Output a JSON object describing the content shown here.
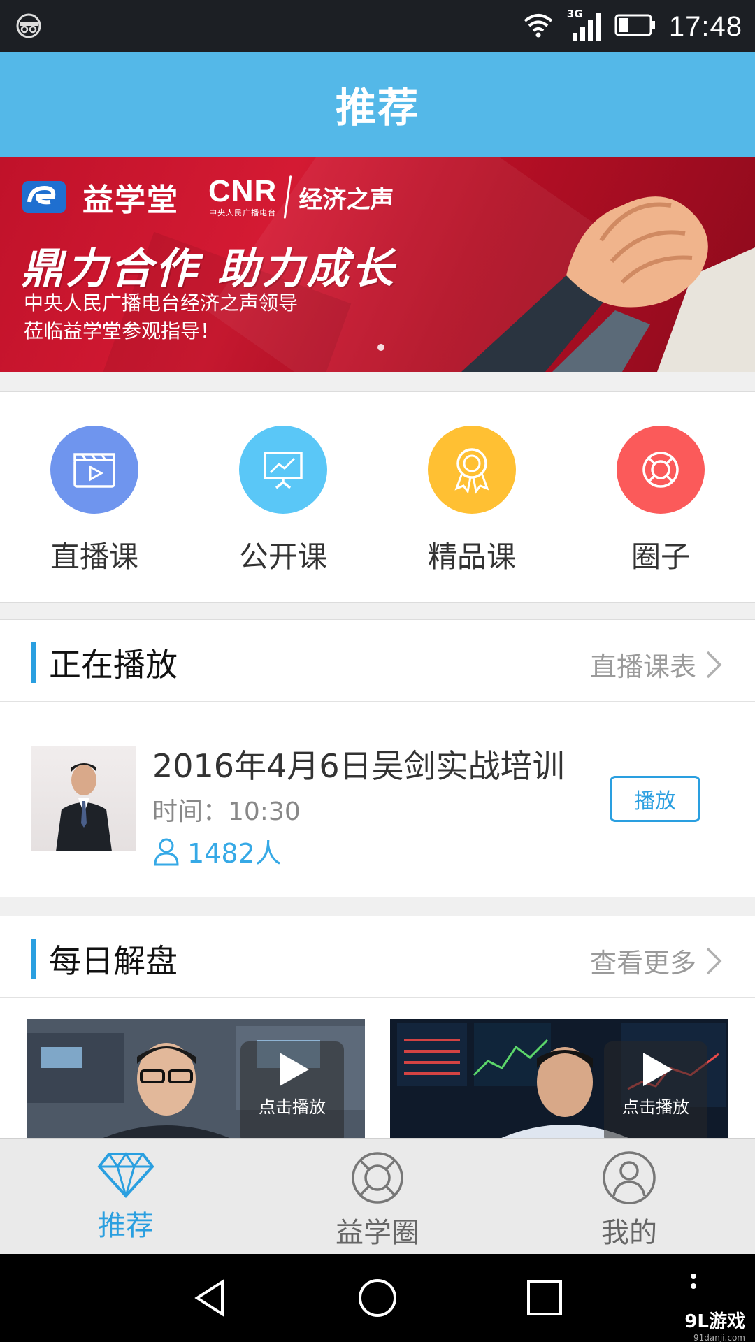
{
  "status": {
    "time": "17:48",
    "network": "3G"
  },
  "header": {
    "title": "推荐"
  },
  "banner": {
    "brand": "益学堂",
    "partner": "CNR",
    "partner_sub": "中央人民广播电台",
    "partner_channel": "经济之声",
    "headline": "鼎力合作 助力成长",
    "line1": "中央人民广播电台经济之声领导",
    "line2": "莅临益学堂参观指导！"
  },
  "categories": [
    {
      "label": "直播课",
      "icon": "clapperboard-icon",
      "color": "#6f95ee"
    },
    {
      "label": "公开课",
      "icon": "presentation-board-icon",
      "color": "#5ac7f7"
    },
    {
      "label": "精品课",
      "icon": "award-ribbon-icon",
      "color": "#ffc033"
    },
    {
      "label": "圈子",
      "icon": "lifebuoy-icon",
      "color": "#fb5a5a"
    }
  ],
  "now_playing": {
    "title": "正在播放",
    "more": "直播课表",
    "item": {
      "title": "2016年4月6日吴剑实战培训",
      "time": "时间：10:30",
      "count": "1482人",
      "play_label": "播放"
    }
  },
  "daily": {
    "title": "每日解盘",
    "more": "查看更多",
    "videos": [
      {
        "play_label": "点击播放"
      },
      {
        "play_label": "点击播放"
      }
    ]
  },
  "tabs": [
    {
      "label": "推荐",
      "icon": "diamond-icon",
      "active": true
    },
    {
      "label": "益学圈",
      "icon": "lifebuoy-icon",
      "active": false
    },
    {
      "label": "我的",
      "icon": "user-icon",
      "active": false
    }
  ],
  "watermark": {
    "text": "9L游戏",
    "sub": "91danji.com"
  },
  "colors": {
    "accent": "#2a9fe0",
    "header": "#54b8e8",
    "banner": "#c8102e"
  }
}
